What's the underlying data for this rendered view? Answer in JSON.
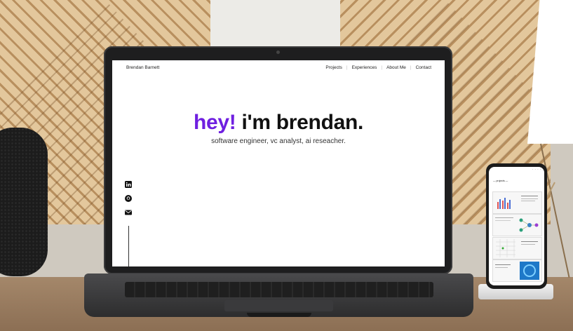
{
  "site": {
    "brand": "Brendan Barnett",
    "nav": [
      "Projects",
      "Experiences",
      "About Me",
      "Contact"
    ],
    "hero": {
      "greeting": "hey!",
      "name_line": "i'm brendan.",
      "subtitle": "software engineer, vc analyst, ai reseacher."
    },
    "social_icons": [
      "linkedin-icon",
      "github-icon",
      "mail-icon"
    ],
    "accent_color": "#6f1fe0"
  },
  "phone": {
    "section_title": "projects"
  }
}
